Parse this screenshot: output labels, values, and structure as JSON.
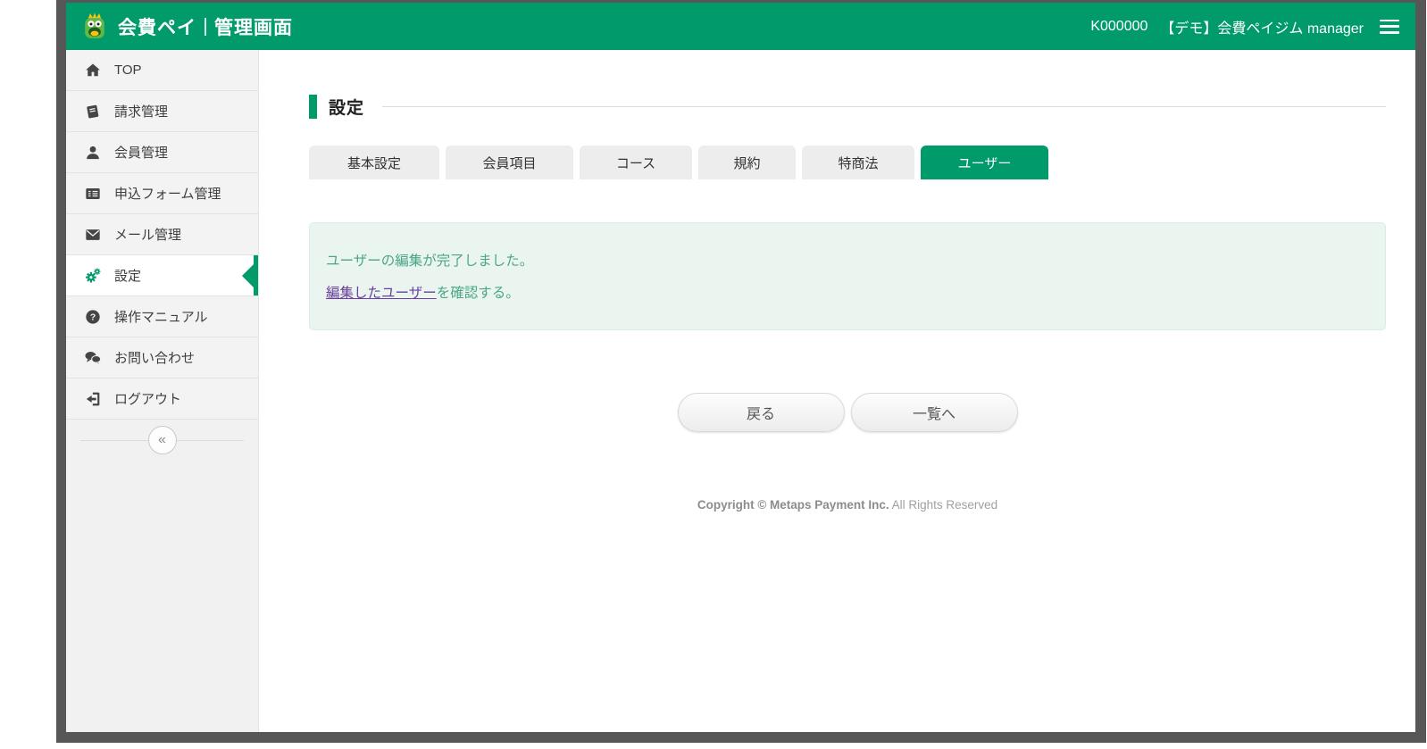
{
  "header": {
    "brand": "会費ペイ",
    "brand_suffix": "管理画面",
    "account_code": "K000000",
    "account_name": "【デモ】会費ペイジム manager"
  },
  "sidebar": {
    "items": [
      {
        "label": "TOP",
        "icon": "home-icon",
        "active": false
      },
      {
        "label": "請求管理",
        "icon": "book-icon",
        "active": false
      },
      {
        "label": "会員管理",
        "icon": "user-icon",
        "active": false
      },
      {
        "label": "申込フォーム管理",
        "icon": "form-icon",
        "active": false
      },
      {
        "label": "メール管理",
        "icon": "mail-icon",
        "active": false
      },
      {
        "label": "設定",
        "icon": "gears-icon",
        "active": true
      },
      {
        "label": "操作マニュアル",
        "icon": "question-icon",
        "active": false
      },
      {
        "label": "お問い合わせ",
        "icon": "chat-icon",
        "active": false
      },
      {
        "label": "ログアウト",
        "icon": "logout-icon",
        "active": false
      }
    ]
  },
  "icons": {
    "question_glyph": "?",
    "collapse_glyph": "«"
  },
  "main": {
    "page_title": "設定",
    "tabs": [
      {
        "label": "基本設定",
        "active": false
      },
      {
        "label": "会員項目",
        "active": false
      },
      {
        "label": "コース",
        "active": false
      },
      {
        "label": "規約",
        "active": false
      },
      {
        "label": "特商法",
        "active": false
      },
      {
        "label": "ユーザー",
        "active": true
      }
    ],
    "message": {
      "line1": "ユーザーの編集が完了しました。",
      "line2_link": "編集したユーザー",
      "line2_rest": "を確認する。"
    },
    "buttons": {
      "back": "戻る",
      "to_list": "一覧へ"
    }
  },
  "footer": {
    "copyright_bold": "Copyright © Metaps Payment Inc.",
    "copyright_rest": " All Rights Reserved"
  },
  "colors": {
    "brand_green": "#009a6b",
    "message_bg": "#eaf5f0",
    "message_text": "#4ba687",
    "link_purple": "#6a3f9e",
    "window_frame": "#575757"
  }
}
